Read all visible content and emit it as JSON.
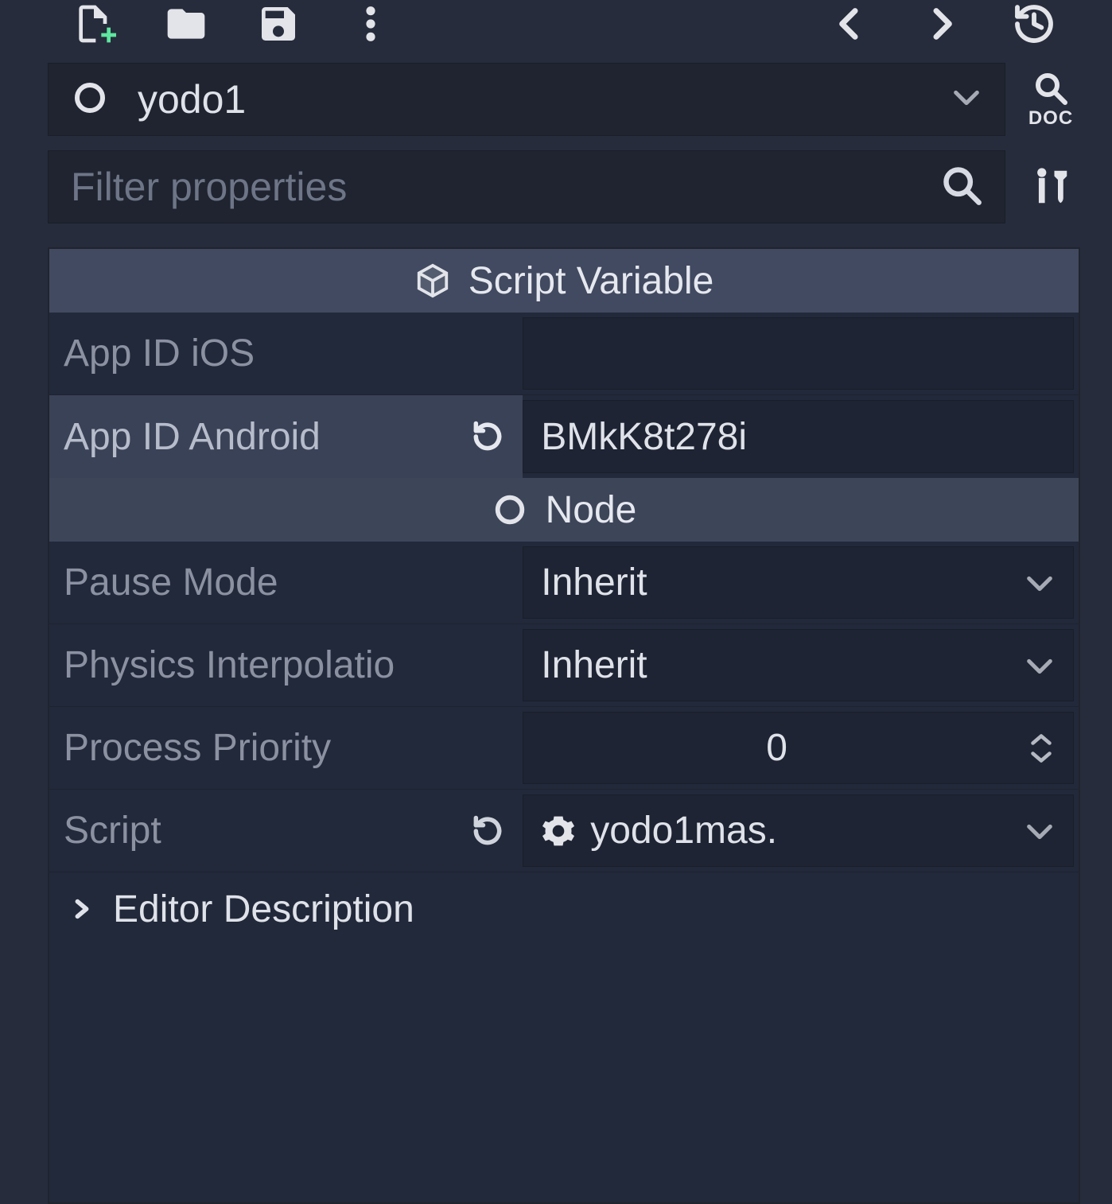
{
  "toolbar_icons": [
    "new-file",
    "folder",
    "save",
    "more",
    "back",
    "forward",
    "history"
  ],
  "node": {
    "name": "yodo1"
  },
  "doc_label": "DOC",
  "filter": {
    "placeholder": "Filter properties"
  },
  "sections": {
    "script_vars": {
      "title": "Script Variable",
      "rows": [
        {
          "label": "App ID iOS",
          "value": "",
          "modified": false,
          "type": "text"
        },
        {
          "label": "App ID Android",
          "value": "BMkK8t278i",
          "modified": true,
          "type": "text"
        }
      ]
    },
    "node": {
      "title": "Node",
      "rows": [
        {
          "label": "Pause Mode",
          "value": "Inherit",
          "type": "enum"
        },
        {
          "label": "Physics Interpolatio",
          "value": "Inherit",
          "type": "enum"
        },
        {
          "label": "Process Priority",
          "value": "0",
          "type": "int"
        },
        {
          "label": "Script",
          "value": "yodo1mas.",
          "type": "script",
          "modified": true
        }
      ],
      "expander": "Editor Description"
    }
  }
}
